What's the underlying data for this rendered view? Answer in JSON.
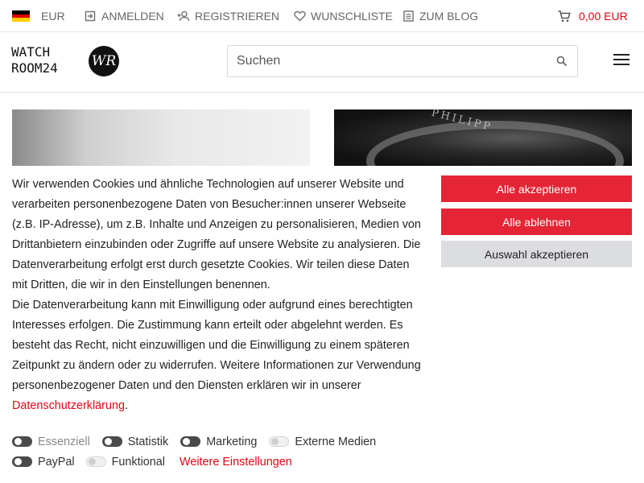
{
  "topbar": {
    "currency": "EUR",
    "login": "ANMELDEN",
    "register": "REGISTRIEREN",
    "wishlist": "WUNSCHLISTE",
    "blog": "ZUM BLOG",
    "cart_total": "0,00 EUR",
    "icons": [
      "germany-flag-icon",
      "login-icon",
      "register-icon",
      "heart-icon",
      "blog-icon",
      "cart-icon"
    ]
  },
  "header": {
    "logo_line1": "WATCH",
    "logo_line2": "ROOM24",
    "logo_mark": "WR",
    "search_placeholder": "Suchen"
  },
  "hero": {
    "right_engraving": "PHILIPP"
  },
  "cookie": {
    "text_1": "Wir verwenden Cookies und ähnliche Technologien auf unserer Website und verarbeiten personenbezogene Daten von Besucher:innen unserer Webseite (z.B. IP-Adresse), um z.B. Inhalte und Anzeigen zu personalisieren, Medien von Drittanbietern einzubinden oder Zugriffe auf unsere Website zu analysieren. Die Datenverarbeitung erfolgt erst durch gesetzte Cookies. Wir teilen diese Daten mit Dritten, die wir in den Einstellungen benennen.",
    "text_2": "Die Datenverarbeitung kann mit Einwilligung oder aufgrund eines berechtigten Interesses erfolgen. Die Zustimmung kann erteilt oder abgelehnt werden. Es besteht das Recht, nicht einzuwilligen und die Einwilligung zu einem späteren Zeitpunkt zu ändern oder zu widerrufen. Weitere Informationen zur Verwendung personenbezogener Daten und den Diensten erklären wir in unserer ",
    "privacy_link": "Datenschutzerklärung",
    "text_end": ".",
    "accept_all": "Alle akzeptieren",
    "reject_all": "Alle ablehnen",
    "accept_selection": "Auswahl akzeptieren",
    "toggles": {
      "essential": {
        "label": "Essenziell",
        "on": true
      },
      "statistics": {
        "label": "Statistik",
        "on": true
      },
      "marketing": {
        "label": "Marketing",
        "on": true
      },
      "external_media": {
        "label": "Externe Medien",
        "on": false
      },
      "paypal": {
        "label": "PayPal",
        "on": true
      },
      "functional": {
        "label": "Funktional",
        "on": false
      }
    },
    "more_settings": "Weitere Einstellungen"
  },
  "colors": {
    "accent_red": "#e52535",
    "link_red": "#e30613",
    "button_grey": "#dcdde0"
  }
}
